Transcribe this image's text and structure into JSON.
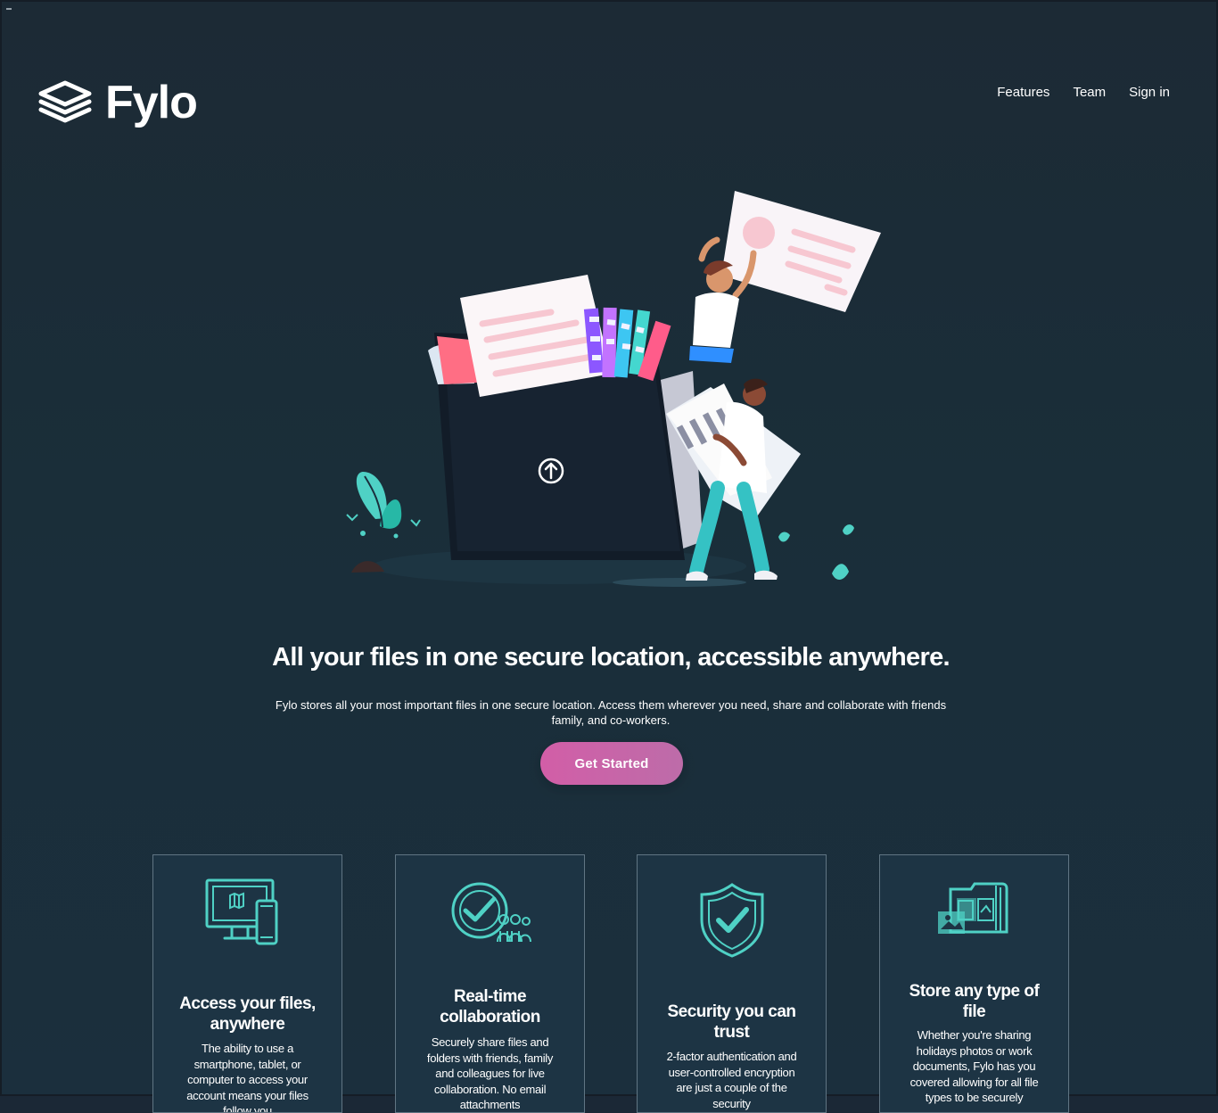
{
  "brand": {
    "name": "Fylo"
  },
  "nav": {
    "items": [
      {
        "label": "Features"
      },
      {
        "label": "Team"
      },
      {
        "label": "Sign in"
      }
    ]
  },
  "hero": {
    "title": "All your files in one secure location, accessible anywhere.",
    "description": "Fylo stores all your most important files in one secure location. Access them wherever you need, share and collaborate with friends family, and co-workers.",
    "cta": "Get Started"
  },
  "features": [
    {
      "title": "Access your files, anywhere",
      "text": "The ability to use a smartphone, tablet, or computer to access your account means your files follow you"
    },
    {
      "title": "Real-time collaboration",
      "text": "Securely share files and folders with friends, family and colleagues for live collaboration. No email attachments"
    },
    {
      "title": "Security you can trust",
      "text": "2-factor authentication and user-controlled encryption are just a couple of the security"
    },
    {
      "title": "Store any type of file",
      "text": "Whether you're sharing holidays photos or work documents, Fylo has you covered allowing for all file types to be securely"
    }
  ],
  "colors": {
    "background": "#1b2836",
    "accent_pink": "#d25ea7",
    "accent_cyan": "#4fd1c5",
    "card_border": "#607583"
  },
  "icons": {
    "logo": "stacked-layers-icon",
    "upload": "upload-arrow-icon",
    "devices": "devices-icon",
    "collaboration": "collaboration-icon",
    "security": "shield-check-icon",
    "files": "file-types-icon"
  }
}
